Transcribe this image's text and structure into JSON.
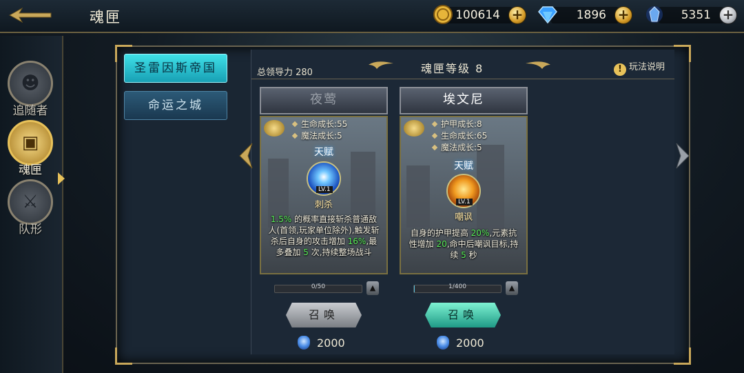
{
  "header": {
    "title": "魂匣",
    "resources": [
      {
        "name": "gold",
        "icon": "gold-coin-icon",
        "value": "100614",
        "add": "+"
      },
      {
        "name": "diamond",
        "icon": "diamond-icon",
        "value": "1896",
        "add": "+"
      },
      {
        "name": "crystal",
        "icon": "blue-crystal-icon",
        "value": "5351",
        "add": "+"
      }
    ]
  },
  "sidebar": {
    "items": [
      {
        "label": "追随者",
        "icon": "follower-head-icon",
        "active": false
      },
      {
        "label": "魂匣",
        "icon": "soul-box-icon",
        "active": true
      },
      {
        "label": "队形",
        "icon": "crossed-swords-icon",
        "active": false
      }
    ]
  },
  "regions": [
    {
      "label": "圣雷因斯帝国",
      "active": true
    },
    {
      "label": "命运之城",
      "active": false
    }
  ],
  "panel": {
    "leadership": "总领导力 280",
    "level": "魂匣等级 8",
    "help": "玩法说明"
  },
  "cards": [
    {
      "name": "夜莺",
      "stats": [
        "生命成长:55",
        "魔法成长:5"
      ],
      "talent_title": "天赋",
      "skill_level": "LV.1",
      "skill_name": "刺杀",
      "desc_parts": [
        {
          "text": "1.5%",
          "hl": true
        },
        {
          "text": " 的概率直接斩杀普通敌人(首领,玩家单位除外),触发斩杀后自身的攻击增加 ",
          "hl": false
        },
        {
          "text": "16%",
          "hl": true
        },
        {
          "text": ",最多叠加 ",
          "hl": false
        },
        {
          "text": "5",
          "hl": true
        },
        {
          "text": " 次,持续整场战斗",
          "hl": false
        }
      ],
      "progress": "0/50",
      "progress_value": 0,
      "summon": "召唤",
      "cost": "2000"
    },
    {
      "name": "埃文尼",
      "stats": [
        "护甲成长:8",
        "生命成长:65",
        "魔法成长:5"
      ],
      "talent_title": "天赋",
      "skill_level": "LV.1",
      "skill_name": "嘲讽",
      "desc_parts": [
        {
          "text": "自身的护甲提高 ",
          "hl": false
        },
        {
          "text": "20%",
          "hl": true
        },
        {
          "text": ",元素抗性增加 ",
          "hl": false
        },
        {
          "text": "20",
          "hl": true
        },
        {
          "text": ",命中后嘲讽目标,持续 ",
          "hl": false
        },
        {
          "text": "5",
          "hl": true
        },
        {
          "text": " 秒",
          "hl": false
        }
      ],
      "progress": "1/400",
      "progress_value": 0.0025,
      "summon": "召唤",
      "cost": "2000"
    }
  ]
}
